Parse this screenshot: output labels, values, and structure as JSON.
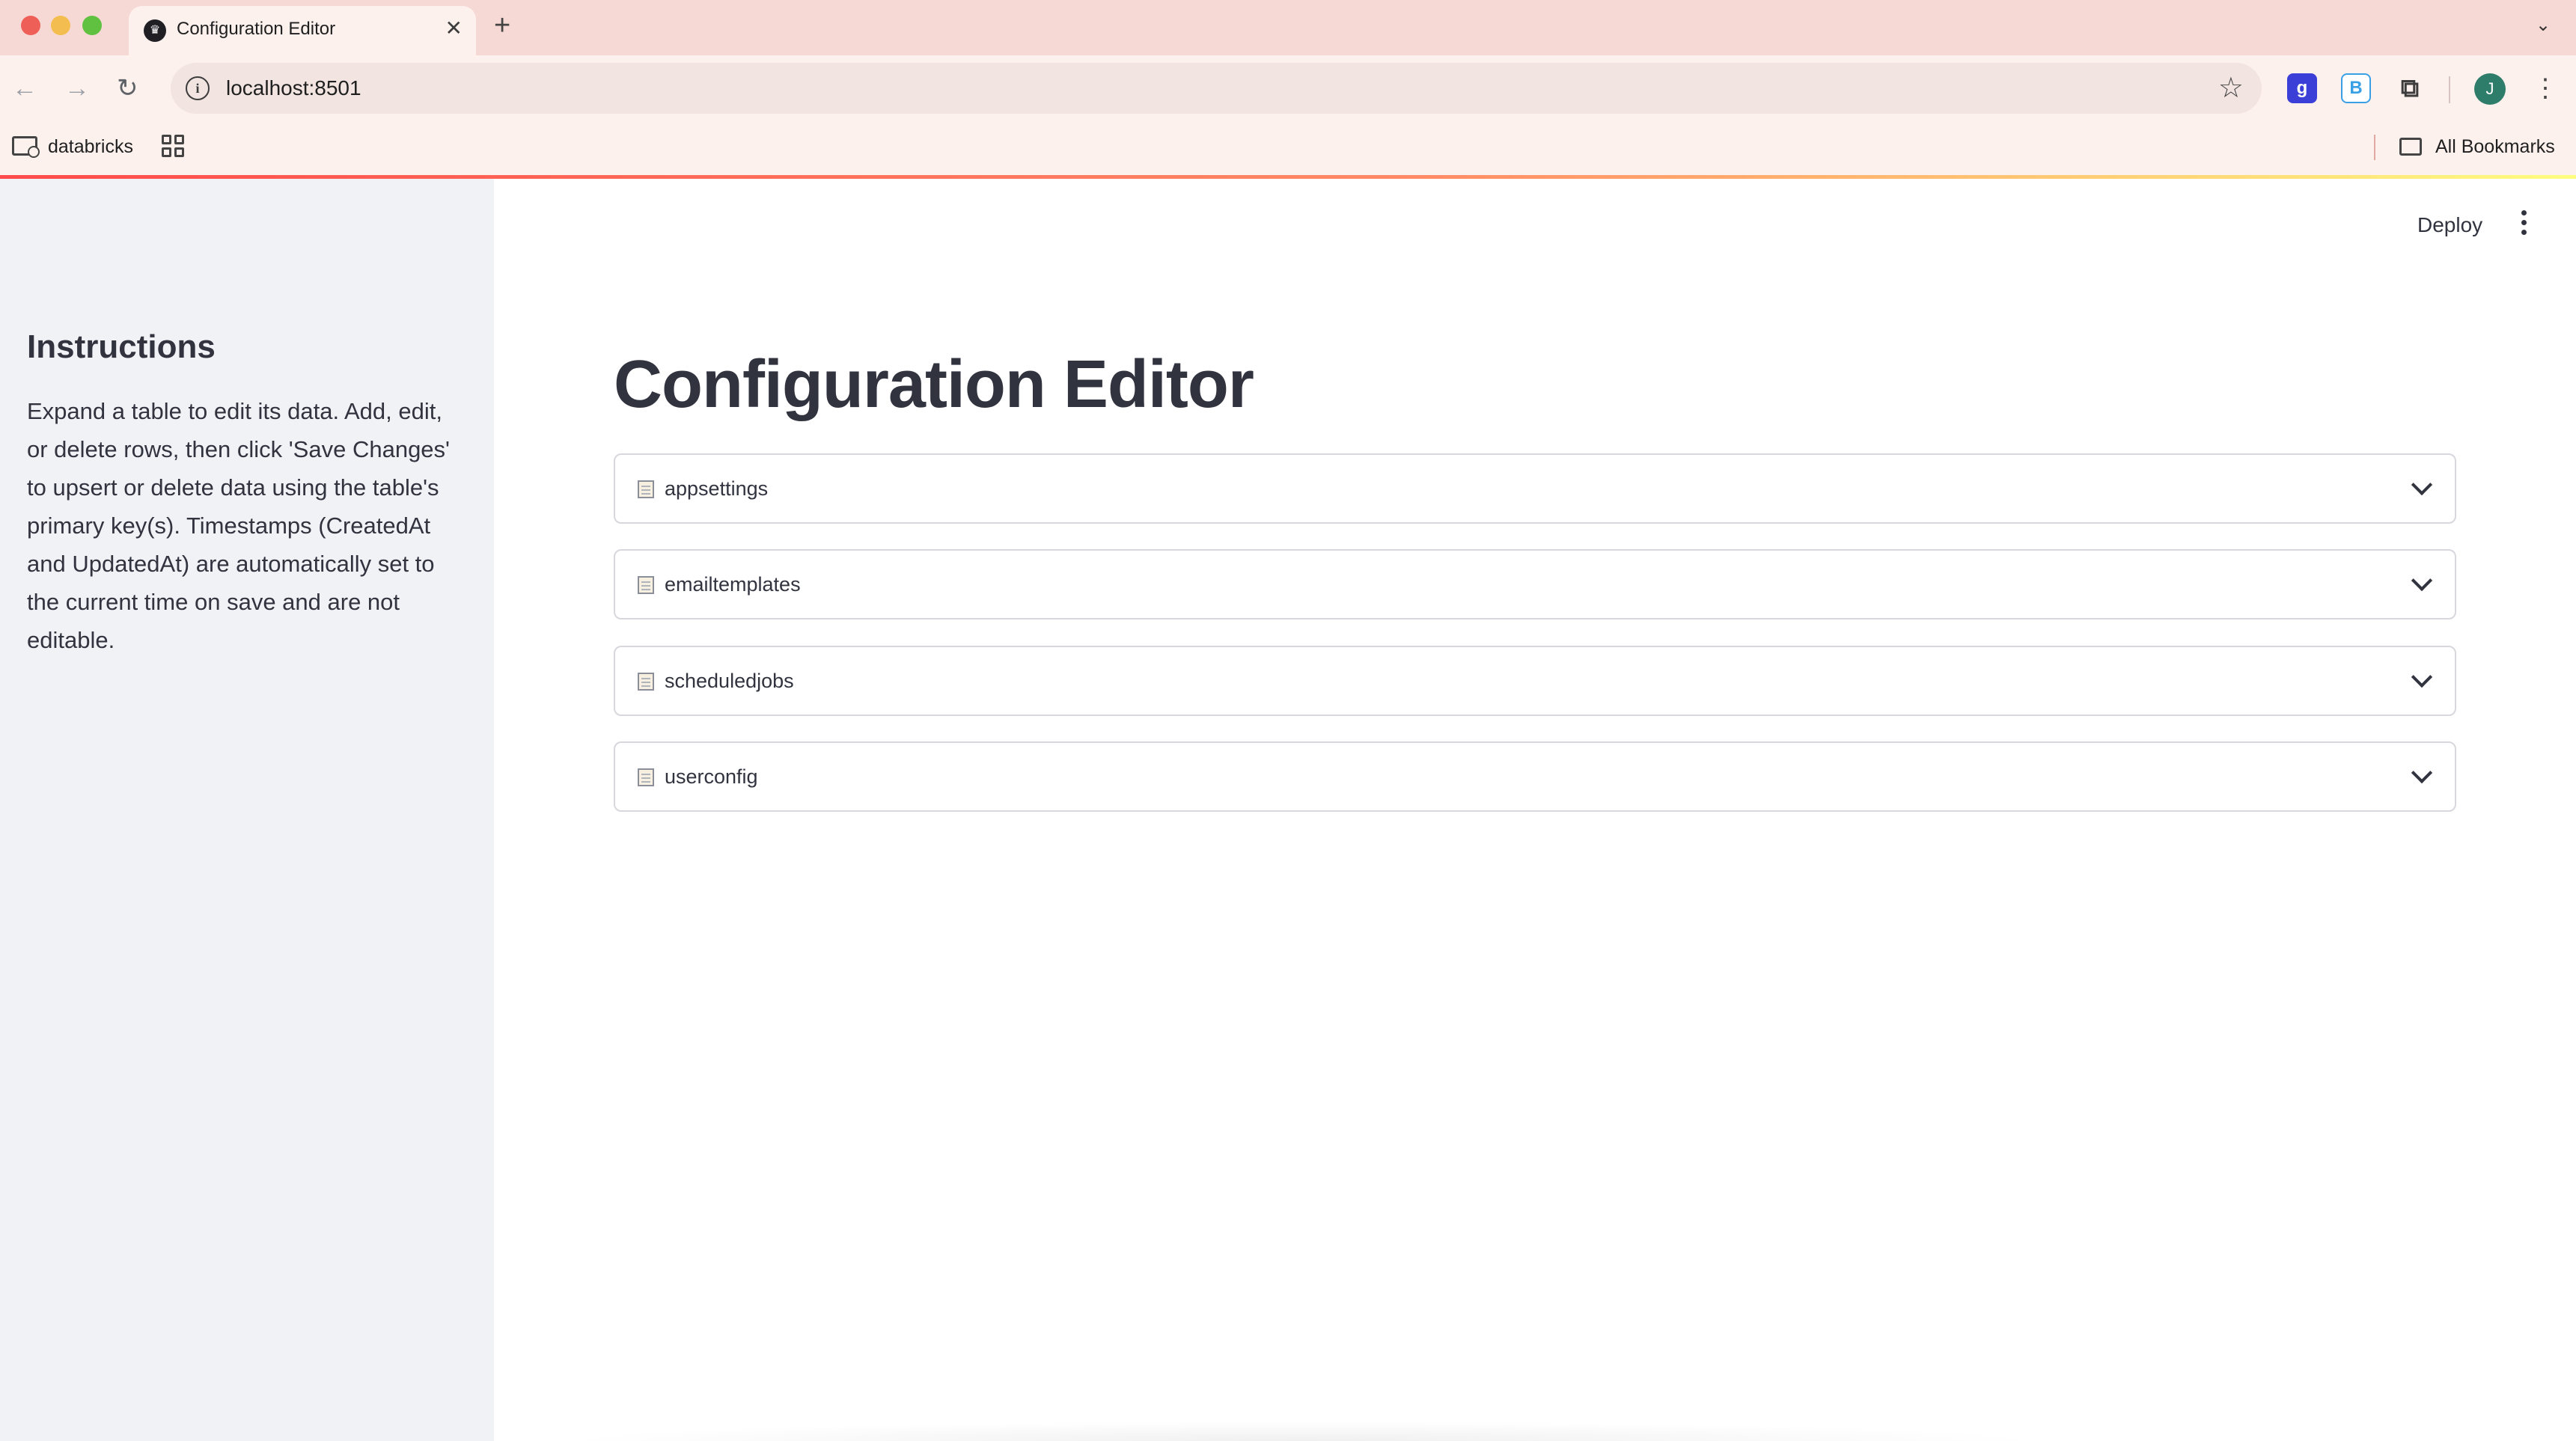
{
  "browser": {
    "tab_title": "Configuration Editor",
    "tab_close": "✕",
    "new_tab": "+",
    "url": "localhost:8501",
    "bookmarks": {
      "folder_label": "databricks",
      "all_bookmarks_label": "All Bookmarks"
    },
    "profile_initial": "J",
    "extensions": [
      "g",
      "B"
    ]
  },
  "header": {
    "deploy_label": "Deploy"
  },
  "sidebar": {
    "heading": "Instructions",
    "text": "Expand a table to edit its data. Add, edit, or delete rows, then click 'Save Changes' to upsert or delete data using the table's primary key(s). Timestamps (CreatedAt and UpdatedAt) are automatically set to the current time on save and are not editable."
  },
  "main": {
    "title": "Configuration Editor",
    "tables": [
      {
        "label": "appsettings"
      },
      {
        "label": "emailtemplates"
      },
      {
        "label": "scheduledjobs"
      },
      {
        "label": "userconfig"
      }
    ]
  },
  "colors": {
    "sidebar_bg": "#f0f2f6",
    "text": "#31333f",
    "accent_gradient_start": "#ff4b4b",
    "accent_gradient_end": "#fffd80"
  }
}
